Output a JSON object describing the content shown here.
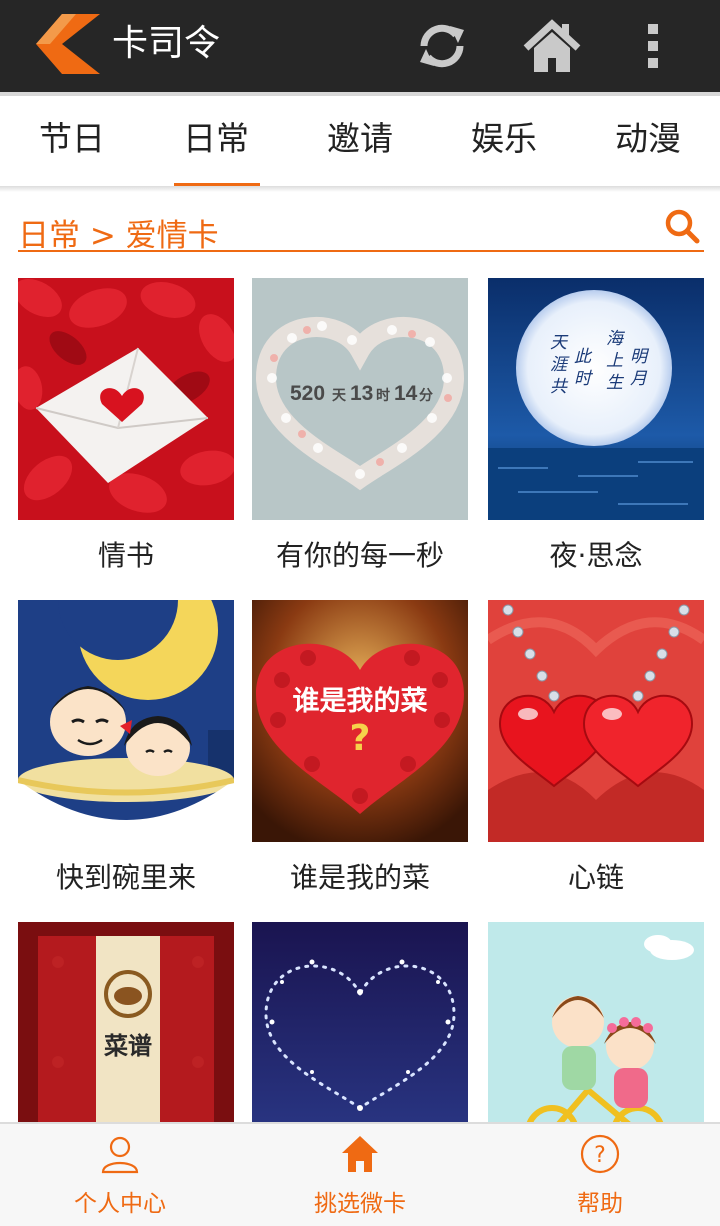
{
  "app": {
    "title": "卡司令"
  },
  "actions": {
    "refresh_icon": "refresh-icon",
    "home_icon": "home-icon",
    "more_icon": "overflow-menu-icon"
  },
  "tabs": [
    {
      "label": "节日",
      "active": false
    },
    {
      "label": "日常",
      "active": true
    },
    {
      "label": "邀请",
      "active": false
    },
    {
      "label": "娱乐",
      "active": false
    },
    {
      "label": "动漫",
      "active": false
    }
  ],
  "breadcrumb": {
    "text": "日常 > 爱情卡"
  },
  "cards": [
    {
      "title": "情书"
    },
    {
      "title": "有你的每一秒",
      "counter": {
        "days": "520",
        "day_unit": "天",
        "hours": "13",
        "hour_unit": "时",
        "minutes": "14",
        "minute_unit": "分"
      }
    },
    {
      "title": "夜·思念",
      "poem": "天涯共此时 海上生明月"
    },
    {
      "title": "快到碗里来"
    },
    {
      "title": "谁是我的菜",
      "caption": "谁是我的菜",
      "mark": "?"
    },
    {
      "title": "心链"
    },
    {
      "title": "",
      "caption": "菜谱"
    },
    {
      "title": ""
    },
    {
      "title": ""
    }
  ],
  "bottom_nav": [
    {
      "label": "个人中心",
      "icon": "person-icon"
    },
    {
      "label": "挑选微卡",
      "icon": "home-icon"
    },
    {
      "label": "帮助",
      "icon": "help-icon"
    }
  ],
  "colors": {
    "accent": "#ef6a13",
    "actionbar": "#262626",
    "text": "#222222"
  }
}
